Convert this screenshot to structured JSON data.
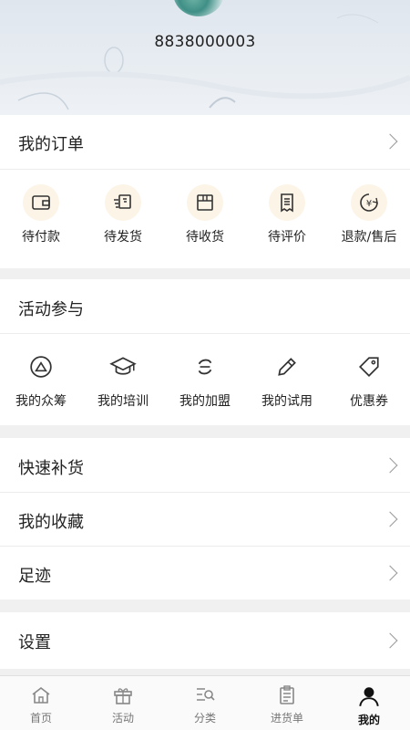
{
  "profile": {
    "phone": "8838000003"
  },
  "orders": {
    "title": "我的订单",
    "items": [
      {
        "label": "待付款",
        "icon": "wallet-icon"
      },
      {
        "label": "待发货",
        "icon": "delivery-icon"
      },
      {
        "label": "待收货",
        "icon": "package-icon"
      },
      {
        "label": "待评价",
        "icon": "receipt-icon"
      },
      {
        "label": "退款/售后",
        "icon": "yen-refund-icon"
      }
    ]
  },
  "activity": {
    "title": "活动参与",
    "items": [
      {
        "label": "我的众筹",
        "icon": "crowdfund-icon"
      },
      {
        "label": "我的培训",
        "icon": "graduation-cap-icon"
      },
      {
        "label": "我的加盟",
        "icon": "join-icon"
      },
      {
        "label": "我的试用",
        "icon": "pencil-icon"
      },
      {
        "label": "优惠券",
        "icon": "tag-icon"
      }
    ]
  },
  "menu": {
    "restock": "快速补货",
    "favorites": "我的收藏",
    "footprints": "足迹",
    "settings": "设置"
  },
  "tabbar": [
    {
      "label": "首页",
      "icon": "home-icon"
    },
    {
      "label": "活动",
      "icon": "gift-icon"
    },
    {
      "label": "分类",
      "icon": "category-search-icon"
    },
    {
      "label": "进货单",
      "icon": "clipboard-icon"
    },
    {
      "label": "我的",
      "icon": "user-icon",
      "active": true
    }
  ],
  "colors": {
    "accent_bg": "#fcf4e6",
    "text": "#222222",
    "page_bg": "#f0f0f0"
  }
}
